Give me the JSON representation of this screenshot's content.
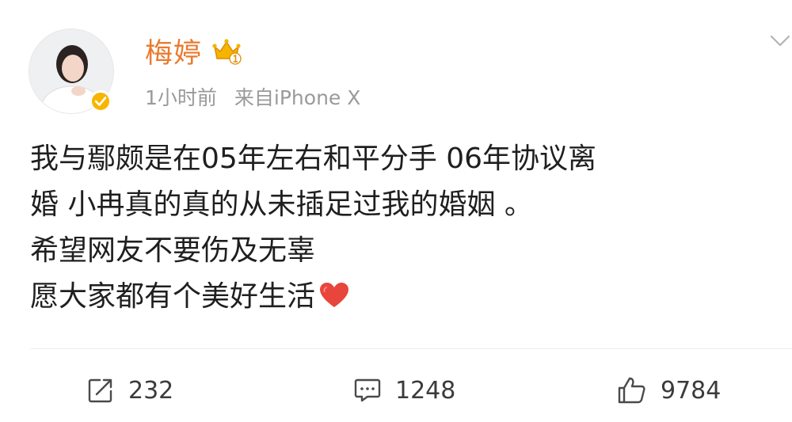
{
  "user": {
    "name": "梅婷",
    "time": "1小时前",
    "source": "来自iPhone X"
  },
  "post": {
    "lines": [
      "我与鄢颇是在05年左右和平分手  06年协议离",
      "婚 小冉真的真的从未插足过我的婚姻 。",
      "希望网友不要伤及无辜",
      "愿大家都有个美好生活"
    ]
  },
  "actions": {
    "reposts": "232",
    "comments": "1248",
    "likes": "9784"
  },
  "icons": {
    "repost": "repost-icon",
    "comment": "comment-icon",
    "like": "thumbs-up-icon",
    "more": "chevron-down-icon",
    "verified": "verified-badge-icon",
    "member": "member-crown-icon",
    "heart": "red-heart-emoji"
  },
  "colors": {
    "name": "#ea7a2f",
    "meta": "#9a9a9a",
    "verified": "#f7b500",
    "heart": "#e8453c"
  }
}
